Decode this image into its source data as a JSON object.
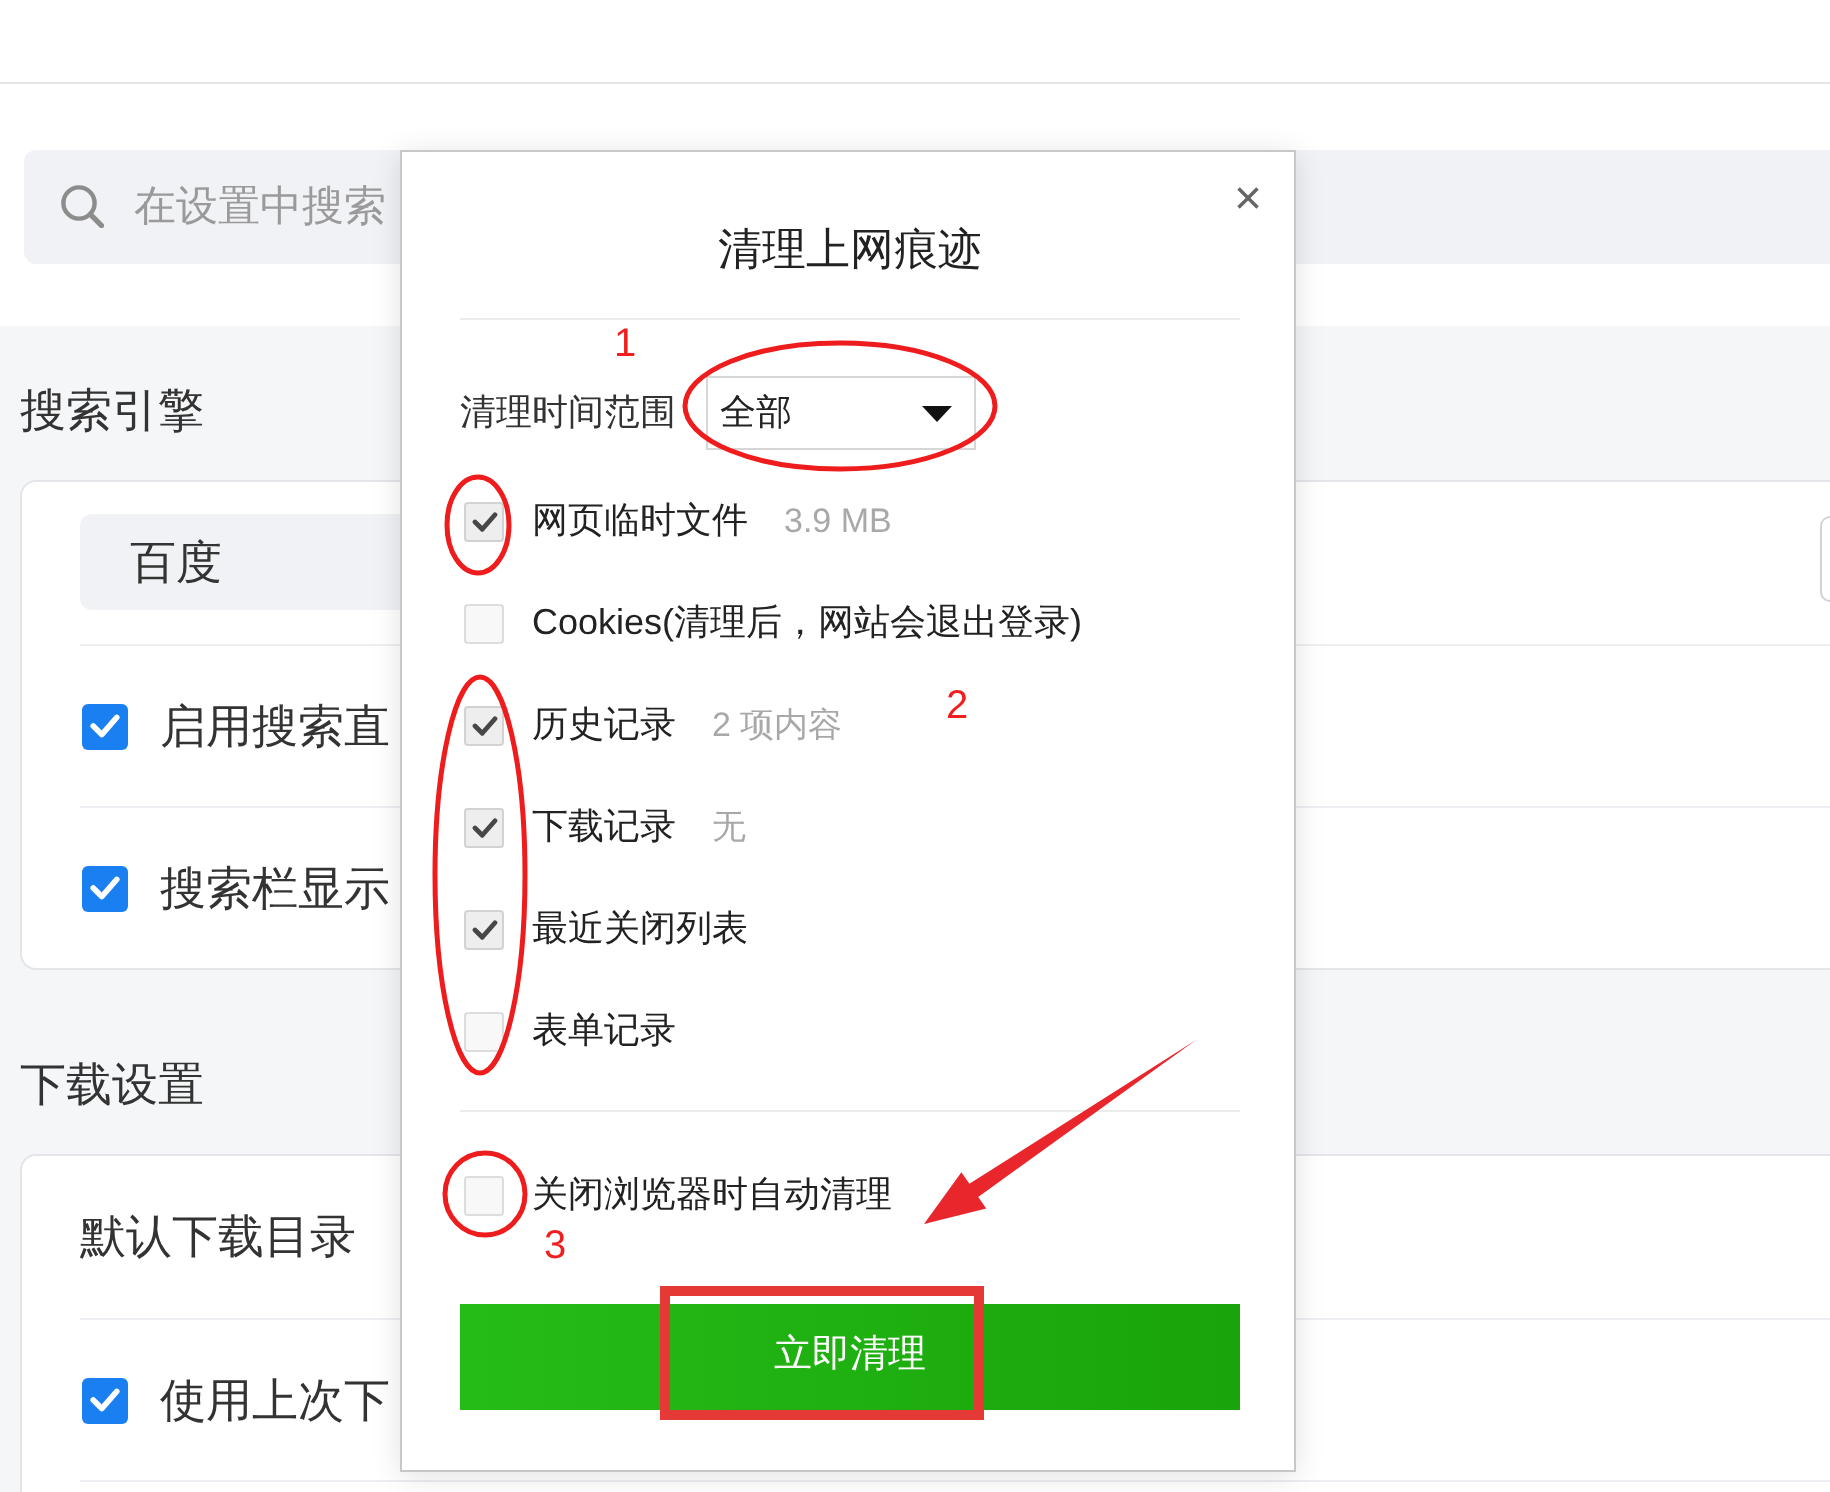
{
  "search": {
    "placeholder": "在设置中搜索"
  },
  "sections": [
    {
      "title": "搜索引擎",
      "rows": [
        {
          "kind": "select",
          "value": "百度"
        },
        {
          "kind": "checkbox",
          "label": "启用搜索直",
          "checked": true
        },
        {
          "kind": "checkbox",
          "label": "搜索栏显示",
          "checked": true
        }
      ]
    },
    {
      "title": "下载设置",
      "rows": [
        {
          "kind": "text",
          "label": "默认下载目录"
        },
        {
          "kind": "checkbox",
          "label": "使用上次下",
          "checked": true
        }
      ]
    }
  ],
  "dialog": {
    "title": "清理上网痕迹",
    "close": "×",
    "time_range": {
      "label": "清理时间范围",
      "value": "全部"
    },
    "items": [
      {
        "label": "网页临时文件",
        "detail": "3.9 MB",
        "checked": true
      },
      {
        "label": "Cookies(清理后，网站会退出登录)",
        "checked": false
      },
      {
        "label": "历史记录",
        "detail": "2 项内容",
        "checked": true
      },
      {
        "label": "下载记录",
        "detail": "无",
        "checked": true
      },
      {
        "label": "最近关闭列表",
        "checked": true
      },
      {
        "label": "表单记录",
        "checked": false
      }
    ],
    "auto_clean": {
      "label": "关闭浏览器时自动清理",
      "checked": false
    },
    "button": "立即清理"
  },
  "annotations": [
    {
      "kind": "ellipse"
    },
    {
      "kind": "number",
      "text": "1"
    },
    {
      "kind": "ellipse"
    },
    {
      "kind": "ellipse"
    },
    {
      "kind": "number",
      "text": "2"
    },
    {
      "kind": "ellipse"
    },
    {
      "kind": "number",
      "text": "3"
    },
    {
      "kind": "arrow"
    },
    {
      "kind": "frame"
    }
  ]
}
